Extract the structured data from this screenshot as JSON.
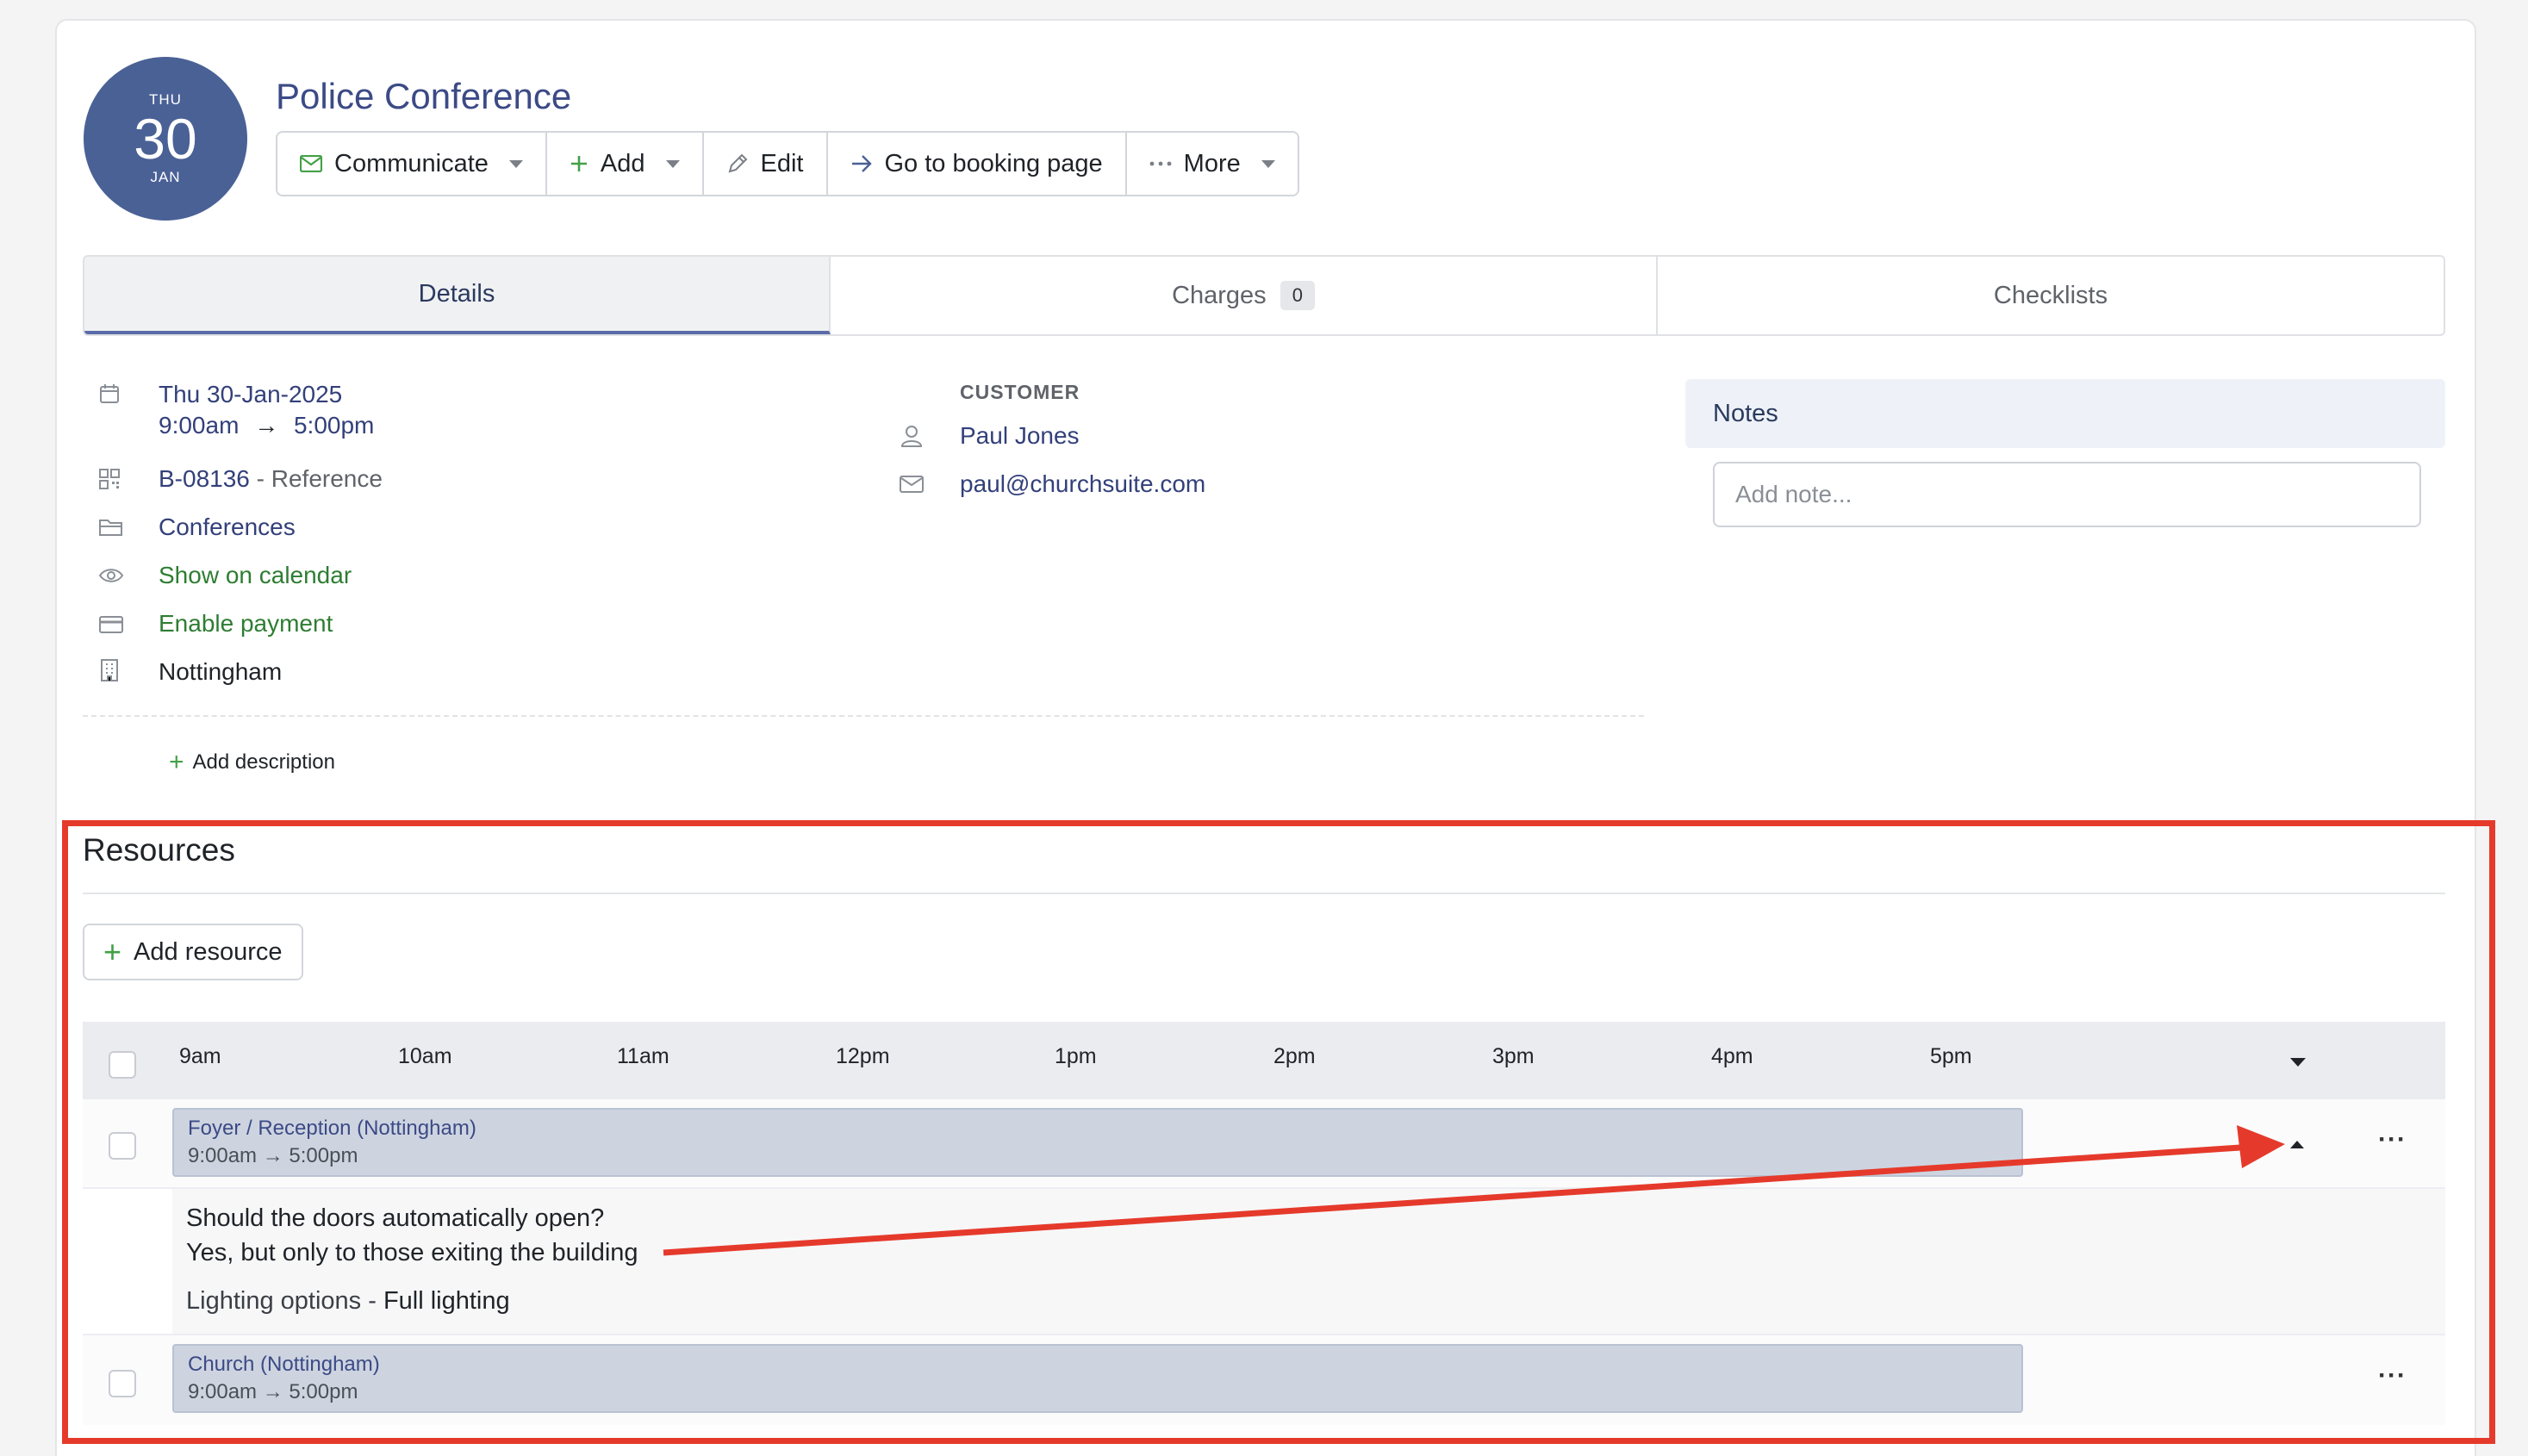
{
  "event": {
    "date_badge": {
      "dow": "THU",
      "day": "30",
      "month": "JAN"
    },
    "title": "Police Conference"
  },
  "toolbar": {
    "communicate": "Communicate",
    "add": "Add",
    "edit": "Edit",
    "go_booking": "Go to booking page",
    "more": "More"
  },
  "tabs": {
    "details": "Details",
    "charges": "Charges",
    "charges_count": "0",
    "checklists": "Checklists"
  },
  "details": {
    "date": "Thu 30-Jan-2025",
    "time_start": "9:00am",
    "time_arrow": "→",
    "time_end": "5:00pm",
    "booking_ref": "B-08136",
    "booking_ref_suffix": " - Reference",
    "category": "Conferences",
    "calendar": "Show on calendar",
    "payment": "Enable payment",
    "site": "Nottingham",
    "add_description": "Add description"
  },
  "customer": {
    "label": "CUSTOMER",
    "name": "Paul Jones",
    "email": "paul@churchsuite.com"
  },
  "notes": {
    "header": "Notes",
    "placeholder": "Add note..."
  },
  "resources": {
    "title": "Resources",
    "add_button": "Add resource",
    "hours": [
      "9am",
      "10am",
      "11am",
      "12pm",
      "1pm",
      "2pm",
      "3pm",
      "4pm",
      "5pm"
    ],
    "rows": [
      {
        "name": "Foyer / Reception (Nottingham)",
        "time": "9:00am → 5:00pm",
        "question": "Should the doors automatically open?",
        "answer": "Yes, but only to those exiting the building",
        "option_label": "Lighting options - ",
        "option_value": "Full lighting"
      },
      {
        "name": "Church (Nottingham)",
        "time": "9:00am → 5:00pm"
      }
    ],
    "more_label": "···"
  },
  "colors": {
    "accent": "#4a6196",
    "link": "#33407a",
    "green": "#2e7d32",
    "annotation": "#e53a2b"
  }
}
